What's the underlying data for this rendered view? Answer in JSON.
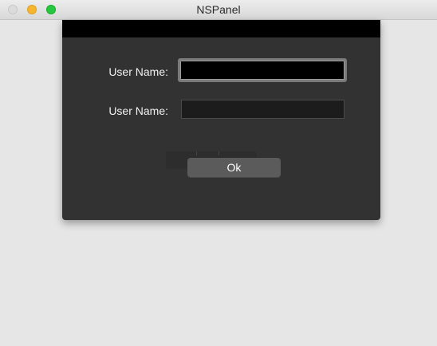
{
  "window": {
    "title": "NSPanel"
  },
  "sheet": {
    "fields": [
      {
        "label": "User Name:",
        "value": "",
        "focused": true
      },
      {
        "label": "User Name:",
        "value": "",
        "focused": false
      }
    ],
    "ok_label": "Ok"
  },
  "colors": {
    "sheet_background": "#323232",
    "sheet_header": "#000000",
    "close_button": "#dcdcdc",
    "minimize_button": "#f5b52e",
    "zoom_button": "#26c840",
    "ok_button": "#5b5b5b"
  }
}
